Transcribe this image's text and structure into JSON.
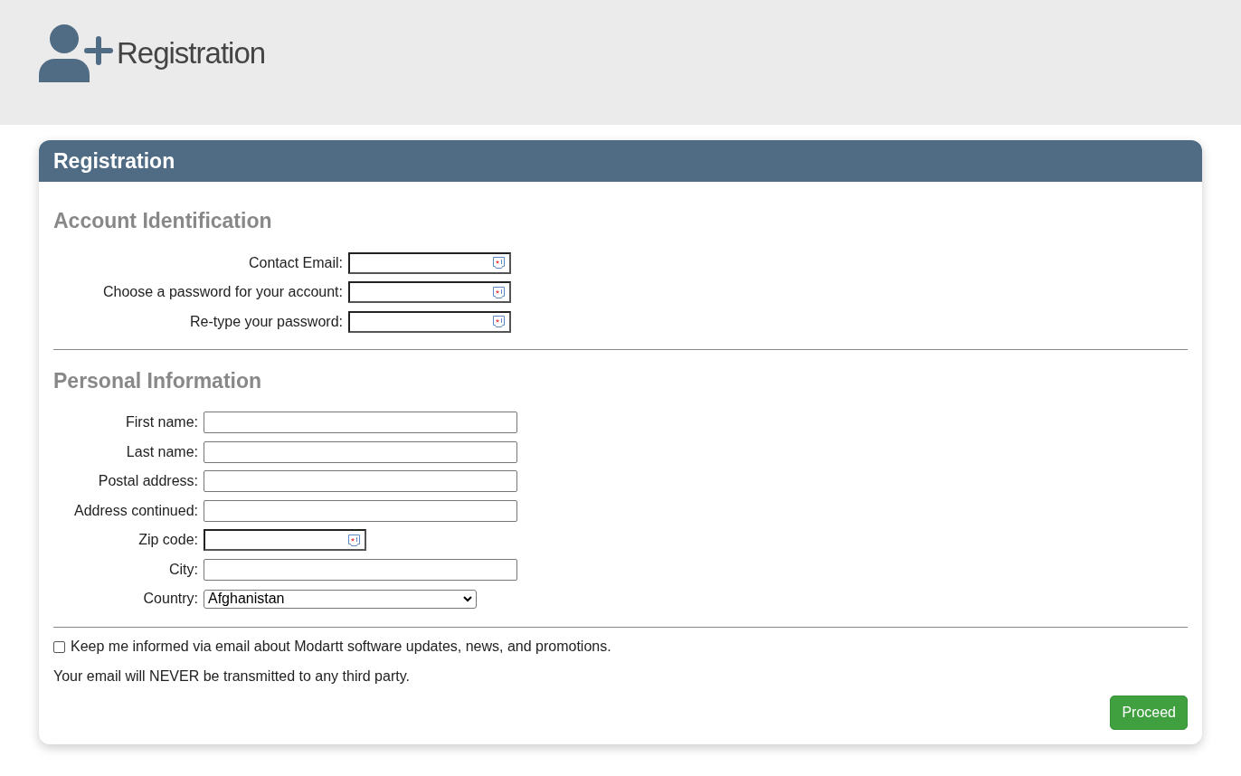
{
  "page_header": {
    "title": "Registration"
  },
  "card": {
    "title": "Registration"
  },
  "sections": [
    {
      "heading": "Account Identification",
      "fields": [
        {
          "label": "Contact Email:",
          "kind": "required"
        },
        {
          "label": "Choose a password for your account:",
          "kind": "required"
        },
        {
          "label": "Re-type your password:",
          "kind": "required"
        }
      ]
    },
    {
      "heading": "Personal Information",
      "fields": [
        {
          "label": "First name:",
          "kind": "text"
        },
        {
          "label": "Last name:",
          "kind": "text"
        },
        {
          "label": "Postal address:",
          "kind": "text"
        },
        {
          "label": "Address continued:",
          "kind": "text"
        },
        {
          "label": "Zip code:",
          "kind": "required"
        },
        {
          "label": "City:",
          "kind": "text"
        },
        {
          "label": "Country:",
          "kind": "select",
          "value": "Afghanistan"
        }
      ]
    }
  ],
  "newsletter": {
    "label": "Keep me informed via email about Modartt software updates, news, and promotions.",
    "checked": false
  },
  "privacy_note": "Your email will NEVER be transmitted to any third party.",
  "proceed_button": "Proceed"
}
